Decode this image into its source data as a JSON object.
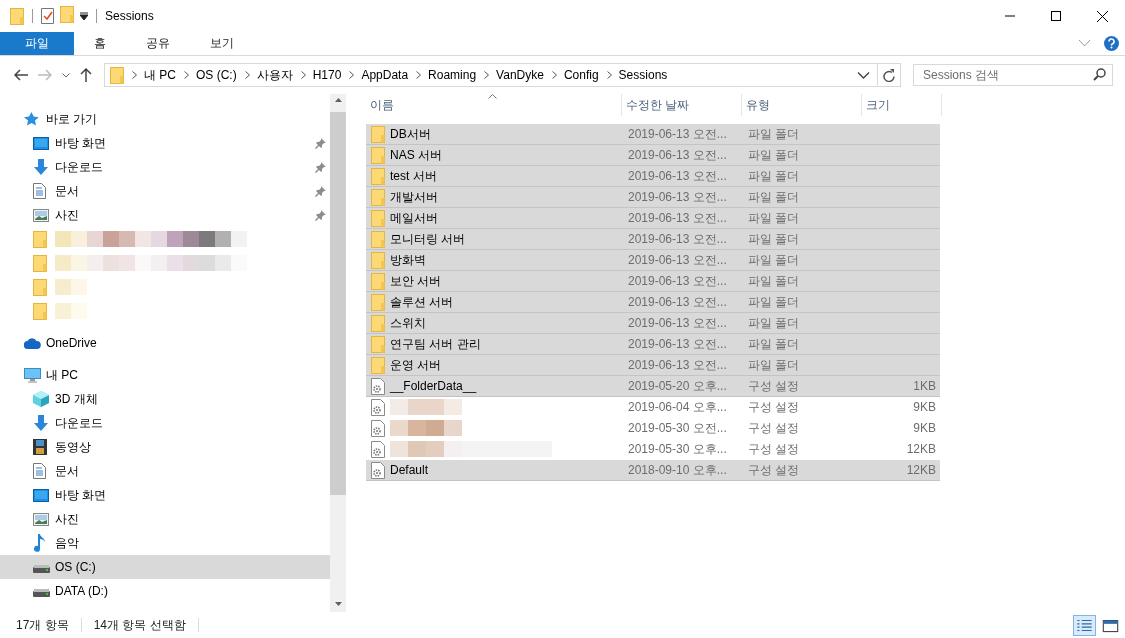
{
  "window": {
    "title": "Sessions"
  },
  "ribbon": {
    "tabs": [
      {
        "label": "파일",
        "selected": true
      },
      {
        "label": "홈",
        "selected": false
      },
      {
        "label": "공유",
        "selected": false
      },
      {
        "label": "보기",
        "selected": false
      }
    ]
  },
  "address": {
    "path": [
      "내 PC",
      "OS (C:)",
      "사용자",
      "H170",
      "AppData",
      "Roaming",
      "VanDyke",
      "Config",
      "Sessions"
    ],
    "search": {
      "placeholder": "Sessions 검색"
    }
  },
  "nav": {
    "groups": [
      {
        "label": "바로 가기",
        "kind": "quick",
        "selected": false,
        "children": [
          {
            "label": "바탕 화면",
            "kind": "desktop",
            "pinned": true,
            "selected": false
          },
          {
            "label": "다운로드",
            "kind": "download",
            "pinned": true,
            "selected": false
          },
          {
            "label": "문서",
            "kind": "documents",
            "pinned": true,
            "selected": false
          },
          {
            "label": "사진",
            "kind": "pictures",
            "pinned": true,
            "selected": false
          },
          {
            "kind": "folder",
            "pinned": false,
            "selected": false
          },
          {
            "kind": "folder",
            "pinned": false,
            "selected": false
          },
          {
            "kind": "folder",
            "pinned": false,
            "selected": false
          },
          {
            "kind": "folder",
            "pinned": false,
            "selected": false
          }
        ]
      },
      {
        "label": "OneDrive",
        "kind": "onedrive",
        "selected": false
      },
      {
        "label": "내 PC",
        "kind": "pc",
        "selected": false,
        "children": [
          {
            "label": "3D 개체",
            "kind": "cube",
            "selected": false
          },
          {
            "label": "다운로드",
            "kind": "download",
            "selected": false
          },
          {
            "label": "동영상",
            "kind": "videos",
            "selected": false
          },
          {
            "label": "문서",
            "kind": "documents",
            "selected": false
          },
          {
            "label": "바탕 화면",
            "kind": "desktop",
            "selected": false
          },
          {
            "label": "사진",
            "kind": "pictures",
            "selected": false
          },
          {
            "label": "음악",
            "kind": "music",
            "selected": false
          },
          {
            "label": "OS (C:)",
            "kind": "drive",
            "selected": true
          },
          {
            "label": "DATA (D:)",
            "kind": "drive",
            "selected": false
          }
        ]
      }
    ]
  },
  "files": {
    "columns": [
      {
        "label": "이름",
        "sorted": true
      },
      {
        "label": "수정한 날짜",
        "sorted": false
      },
      {
        "label": "유형",
        "sorted": false
      },
      {
        "label": "크기",
        "sorted": false
      }
    ],
    "rows": [
      {
        "kind": "folder",
        "name": "DB서버",
        "modified": "2019-06-13 오전...",
        "type": "파일 폴더",
        "selected": true
      },
      {
        "kind": "folder",
        "name": "NAS 서버",
        "modified": "2019-06-13 오전...",
        "type": "파일 폴더",
        "selected": true
      },
      {
        "kind": "folder",
        "name": "test 서버",
        "modified": "2019-06-13 오전...",
        "type": "파일 폴더",
        "selected": true
      },
      {
        "kind": "folder",
        "name": "개발서버",
        "modified": "2019-06-13 오전...",
        "type": "파일 폴더",
        "selected": true
      },
      {
        "kind": "folder",
        "name": "메일서버",
        "modified": "2019-06-13 오전...",
        "type": "파일 폴더",
        "selected": true
      },
      {
        "kind": "folder",
        "name": "모니터링 서버",
        "modified": "2019-06-13 오전...",
        "type": "파일 폴더",
        "selected": true
      },
      {
        "kind": "folder",
        "name": "방화벽",
        "modified": "2019-06-13 오전...",
        "type": "파일 폴더",
        "selected": true
      },
      {
        "kind": "folder",
        "name": "보안 서버",
        "modified": "2019-06-13 오전...",
        "type": "파일 폴더",
        "selected": true
      },
      {
        "kind": "folder",
        "name": "솔루션 서버",
        "modified": "2019-06-13 오전...",
        "type": "파일 폴더",
        "selected": true
      },
      {
        "kind": "folder",
        "name": "스위치",
        "modified": "2019-06-13 오전...",
        "type": "파일 폴더",
        "selected": true
      },
      {
        "kind": "folder",
        "name": "연구팀 서버 관리",
        "modified": "2019-06-13 오전...",
        "type": "파일 폴더",
        "selected": true
      },
      {
        "kind": "folder",
        "name": "운영 서버",
        "modified": "2019-06-13 오전...",
        "type": "파일 폴더",
        "selected": true
      },
      {
        "kind": "config",
        "name": "__FolderData__",
        "modified": "2019-05-20 오후...",
        "type": "구성 설정",
        "size": "1KB",
        "selected": true
      },
      {
        "kind": "config",
        "modified": "2019-06-04 오후...",
        "type": "구성 설정",
        "size": "9KB",
        "selected": false
      },
      {
        "kind": "config",
        "modified": "2019-05-30 오전...",
        "type": "구성 설정",
        "size": "9KB",
        "selected": false
      },
      {
        "kind": "config",
        "modified": "2019-05-30 오후...",
        "type": "구성 설정",
        "size": "12KB",
        "selected": false
      },
      {
        "kind": "config",
        "name": "Default",
        "modified": "2018-09-10 오후...",
        "type": "구성 설정",
        "size": "12KB",
        "selected": true
      }
    ]
  },
  "status_bar": {
    "count": "17개 항목",
    "selection": "14개 항목 선택함",
    "views": [
      {
        "kind": "details",
        "selected": true
      },
      {
        "kind": "tiles",
        "selected": false
      }
    ]
  }
}
